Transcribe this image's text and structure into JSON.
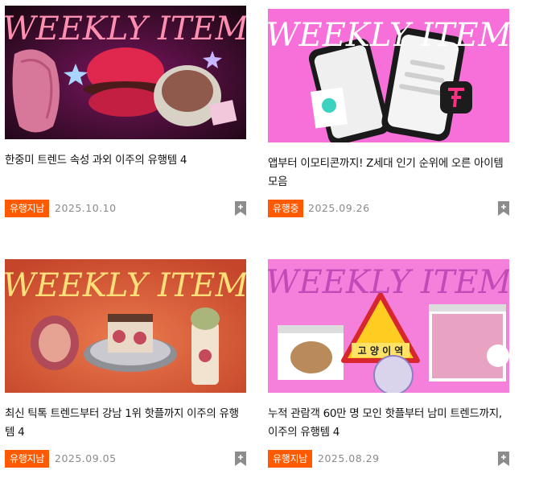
{
  "cards": [
    {
      "banner_text": "WEEKLY ITEM",
      "title": "한중미 트렌드 속성 과외 이주의 유행템 4",
      "badge": "유행지남",
      "date": "2025.10.10"
    },
    {
      "banner_text": "WEEKLY ITEM",
      "title": "앱부터 이모티콘까지! Z세대 인기 순위에 오른 아이템 모음",
      "badge": "유행중",
      "date": "2025.09.26"
    },
    {
      "banner_text": "WEEKLY ITEM",
      "title": "최신 틱톡 트렌드부터 강남 1위 핫플까지 이주의 유행템 4",
      "badge": "유행지남",
      "date": "2025.09.05"
    },
    {
      "banner_text": "WEEKLY ITEM",
      "title": "누적 관람객 60만 명 모인 핫플부터 남미 트렌드까지, 이주의 유행템 4",
      "badge": "유행지남",
      "date": "2025.08.29",
      "sign_text": "고 양 이 역"
    }
  ],
  "colors": {
    "badge": "#ff5a00",
    "date": "#8a8a8a",
    "bookmark": "#8c8c8c"
  }
}
